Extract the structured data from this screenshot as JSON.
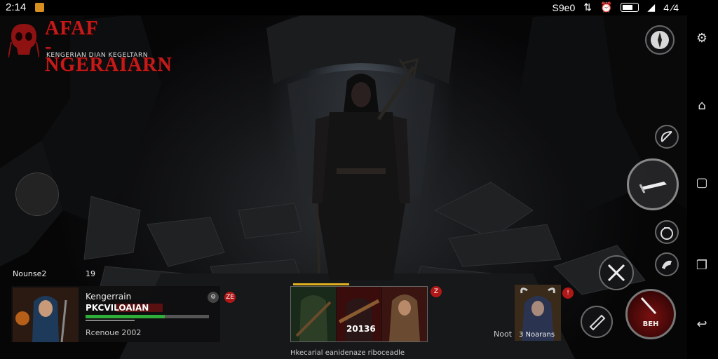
{
  "status_bar": {
    "time": "2:14",
    "signal_text": "S9e0",
    "clock_right": "4 ⁄4"
  },
  "logo": {
    "title_line1": "AFAF",
    "title_line2": "-NGERAIARN",
    "subtitle": "KENGERIAN DIAN KEGELTARN"
  },
  "team": {
    "label": "Nounse2",
    "count": "19"
  },
  "character": {
    "name": "Kengerrain",
    "class": "PKCVILOAIAN",
    "hp_fraction": 0.64,
    "stat": "Rcenoue 2002",
    "badge": "ZE"
  },
  "party": {
    "score": "20136",
    "caption": "Hkecarial eanidenaze riboceadle",
    "badge": "Z"
  },
  "enemy": {
    "node_label": "Noot",
    "name": "3 Noarans",
    "badge": "!"
  },
  "actions": {
    "special_label": "BEH"
  },
  "icons": {
    "compass": "compass-icon",
    "gear": "gear-icon",
    "back": "back-icon",
    "home": "home-icon",
    "recents": "recents-icon",
    "nav_back": "nav-back-icon",
    "bow": "bow-icon",
    "dagger": "dagger-icon",
    "bag": "bag-icon",
    "horn": "horn-icon",
    "swords": "crossed-swords-icon",
    "potion": "potion-icon",
    "special": "special-attack-icon"
  },
  "colors": {
    "logo_red": "#c41a1a",
    "hp_green": "#2fae3a",
    "alert_red": "#b01818"
  }
}
